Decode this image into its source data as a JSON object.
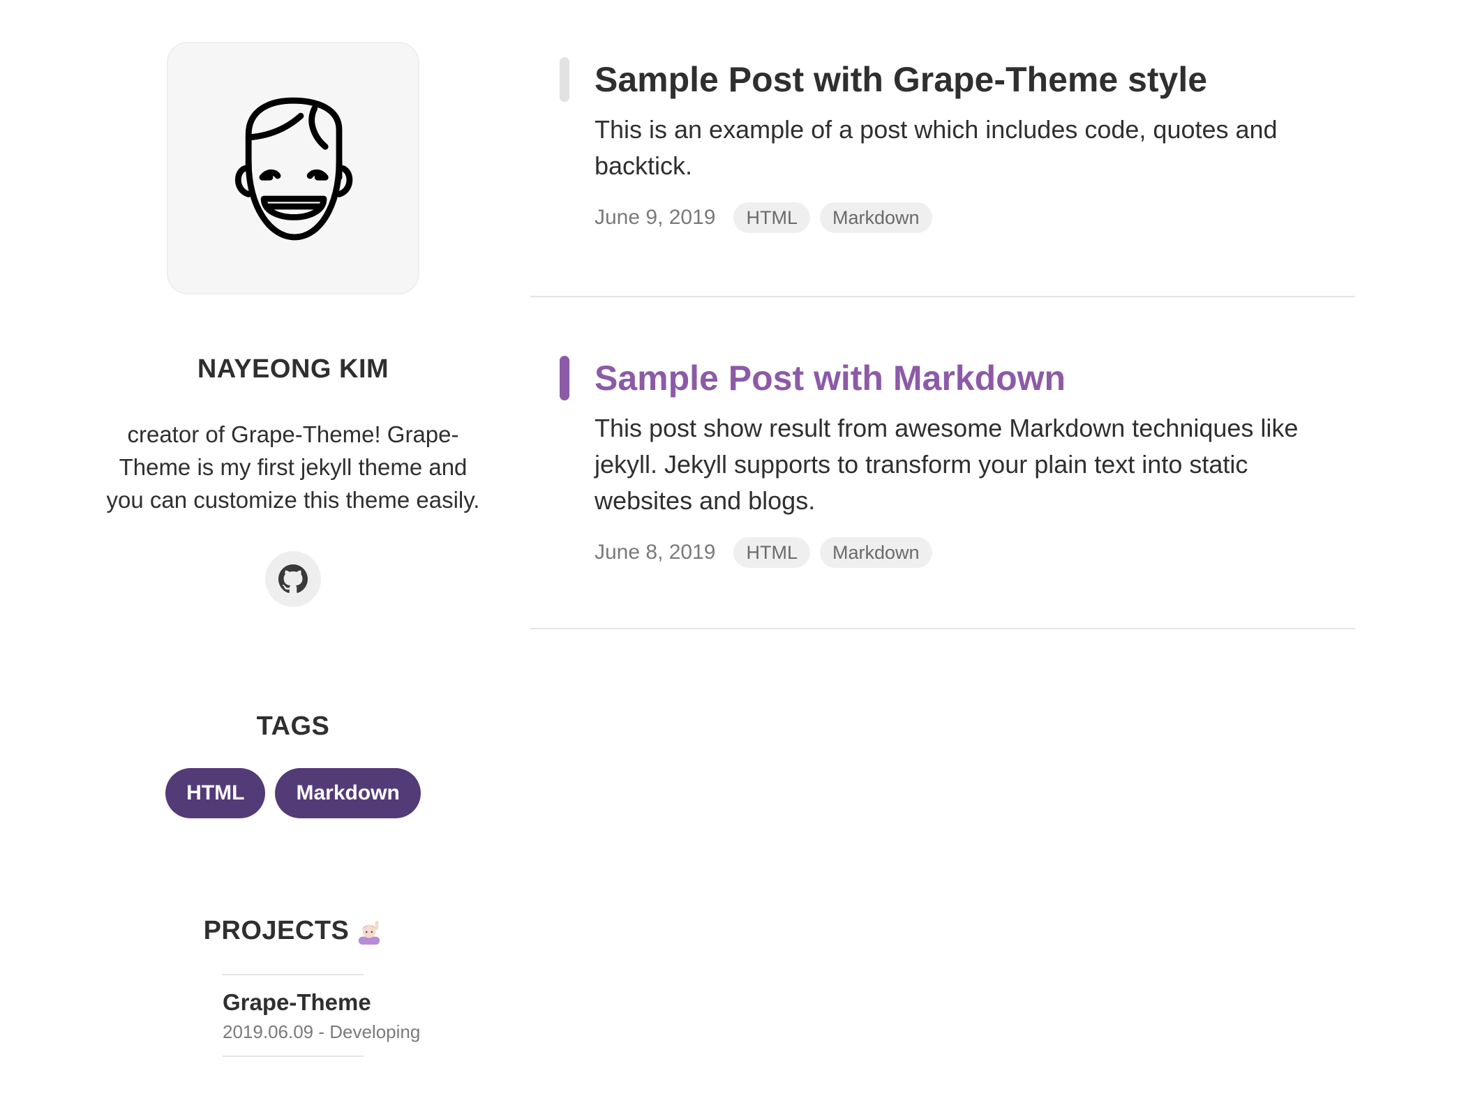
{
  "sidebar": {
    "author_name": "NAYEONG KIM",
    "author_bio": "creator of Grape-Theme! Grape-Theme is my first jekyll theme and you can customize this theme easily.",
    "social_icon": "github-icon",
    "tags_title": "TAGS",
    "tags": [
      {
        "label": "HTML"
      },
      {
        "label": "Markdown"
      }
    ],
    "projects_title": "PROJECTS",
    "projects_emoji": "person-raising-hand-icon",
    "projects": [
      {
        "name": "Grape-Theme",
        "meta": "2019.06.09 - Developing"
      }
    ]
  },
  "posts": [
    {
      "title": "Sample Post with Grape-Theme style",
      "excerpt": "This is an example of a post which includes code, quotes and backtick.",
      "date": "June 9, 2019",
      "tags": [
        "HTML",
        "Markdown"
      ],
      "active": false
    },
    {
      "title": "Sample Post with Markdown",
      "excerpt": "This post show result from awesome Markdown techniques like jekyll. Jekyll supports to transform your plain text into static websites and blogs.",
      "date": "June 8, 2019",
      "tags": [
        "HTML",
        "Markdown"
      ],
      "active": true
    }
  ],
  "colors": {
    "accent": "#8c5aa7",
    "tag_pill": "#533b78",
    "text": "#2f2f2f",
    "muted": "#7a7a7a",
    "avatar_bg": "#f6f6f6"
  }
}
